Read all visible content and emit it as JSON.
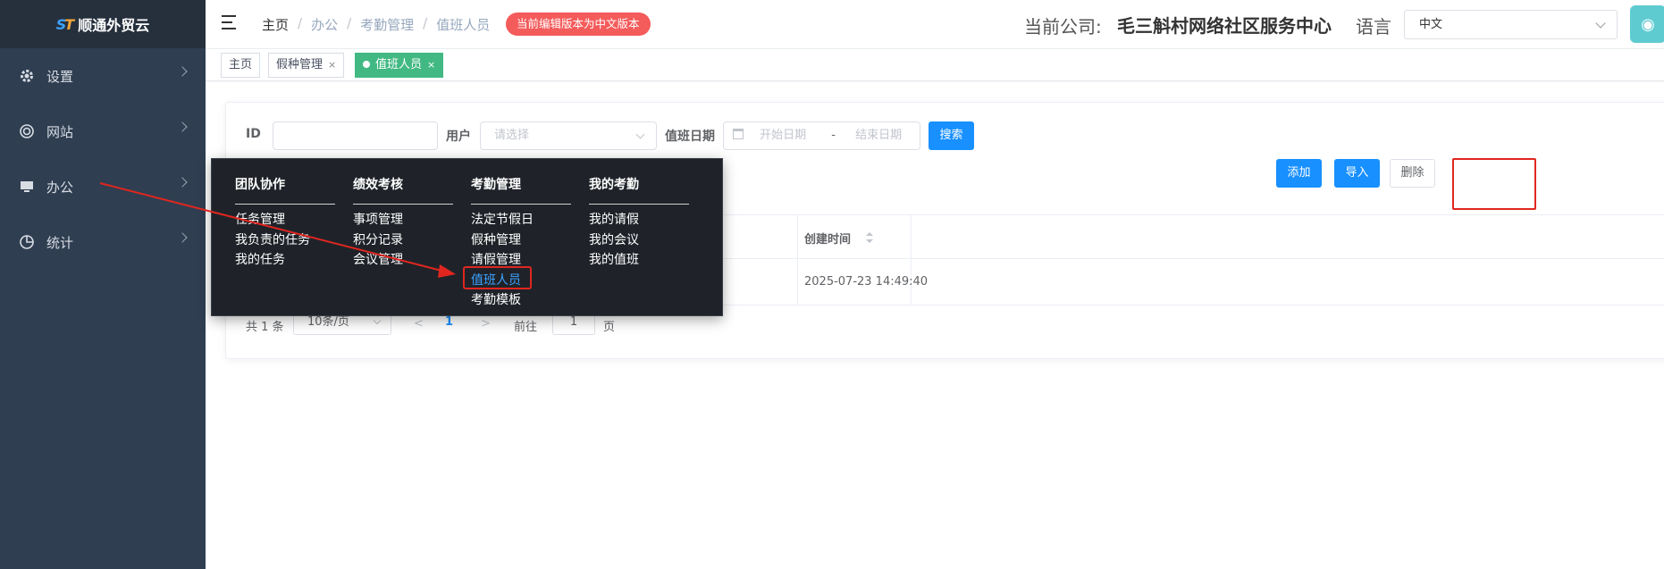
{
  "app": {
    "logo_text": "顺通外贸云",
    "logo_mark": "ST"
  },
  "sidebar": {
    "items": [
      {
        "label": "设置",
        "icon": "gear-icon"
      },
      {
        "label": "网站",
        "icon": "globe-icon"
      },
      {
        "label": "办公",
        "icon": "monitor-icon"
      },
      {
        "label": "统计",
        "icon": "pie-chart-icon"
      }
    ]
  },
  "header": {
    "breadcrumb": [
      "主页",
      "办公",
      "考勤管理",
      "值班人员"
    ],
    "edit_badge": "当前编辑版本为中文版本",
    "company_label": "当前公司:",
    "company_name": "毛三斛村网络社区服务中心",
    "lang_label": "语言",
    "lang_value": "中文"
  },
  "tags": [
    {
      "label": "主页"
    },
    {
      "label": "假种管理"
    },
    {
      "label": "值班人员",
      "active": true
    }
  ],
  "search": {
    "id_label": "ID",
    "id_value": "",
    "user_label": "用户",
    "user_placeholder": "请选择",
    "date_label": "值班日期",
    "date_start": "开始日期",
    "date_sep": "-",
    "date_end": "结束日期",
    "search_button": "搜索"
  },
  "actions": {
    "add": "添加",
    "import": "导入",
    "delete": "删除"
  },
  "table": {
    "columns": [
      "创建时间"
    ],
    "rows": [
      {
        "created": "2025-07-23 14:49:40"
      }
    ]
  },
  "pagination": {
    "total": "共 1 条",
    "page_size": "10条/页",
    "current": "1",
    "goto_label": "前往",
    "goto_value": "1",
    "page_suffix": "页"
  },
  "mega_menu": {
    "columns": [
      {
        "title": "团队协作",
        "items": [
          "任务管理",
          "我负责的任务",
          "我的任务"
        ]
      },
      {
        "title": "绩效考核",
        "items": [
          "事项管理",
          "积分记录",
          "会议管理"
        ]
      },
      {
        "title": "考勤管理",
        "items": [
          "法定节假日",
          "假种管理",
          "请假管理",
          "值班人员",
          "考勤模板"
        ]
      },
      {
        "title": "我的考勤",
        "items": [
          "我的请假",
          "我的会议",
          "我的值班"
        ]
      }
    ],
    "highlighted": "值班人员"
  },
  "colors": {
    "sidebar": "#2f3e51",
    "primary": "#1890ff",
    "tag_active": "#42b983",
    "annotation": "#e0261f",
    "badge": "#f45b5b"
  }
}
